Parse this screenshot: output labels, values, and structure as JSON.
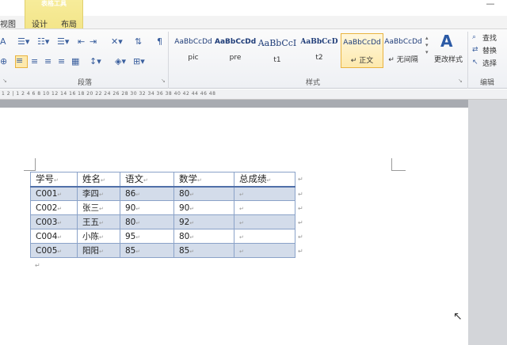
{
  "ribbon_tabs": {
    "context_title": "表格工具",
    "view": "视图",
    "design": "设计",
    "layout": "布局"
  },
  "window": {
    "minimize": "—"
  },
  "groups": {
    "paragraph": "段落",
    "styles": "样式",
    "edit": "编辑"
  },
  "styles_gallery": [
    {
      "sample": "AaBbCcDd",
      "name": "pic"
    },
    {
      "sample": "AaBbCcDd",
      "name": "pre"
    },
    {
      "sample": "AaBbCcI",
      "name": "t1"
    },
    {
      "sample": "AaBbCcD",
      "name": "t2"
    },
    {
      "sample": "AaBbCcDd",
      "name": "↵ 正文"
    },
    {
      "sample": "AaBbCcDd",
      "name": "↵ 无间隔"
    }
  ],
  "change_styles": "更改样式",
  "edit_buttons": {
    "find": "查找",
    "replace": "替换",
    "select": "选择"
  },
  "ruler_text": "1 2 | 1 2 4 6 8 10 12 14 16 18 20 22 24 26 28 30 32 34 36 38 40 42 44 46 48",
  "table": {
    "headers": [
      "学号",
      "姓名",
      "语文",
      "数学",
      "总成绩"
    ],
    "rows": [
      [
        "C001",
        "李四",
        "86",
        "80",
        ""
      ],
      [
        "C002",
        "张三",
        "90",
        "90",
        ""
      ],
      [
        "C003",
        "王五",
        "80",
        "92",
        ""
      ],
      [
        "C004",
        "小陈",
        "95",
        "80",
        ""
      ],
      [
        "C005",
        "阳阳",
        "85",
        "85",
        ""
      ]
    ]
  },
  "marks": {
    "cell": "↵",
    "para": "↵"
  },
  "colors": {
    "table_border": "#8aa2c8",
    "shade": "#d3dcea",
    "context_tab": "#f3e58a"
  }
}
